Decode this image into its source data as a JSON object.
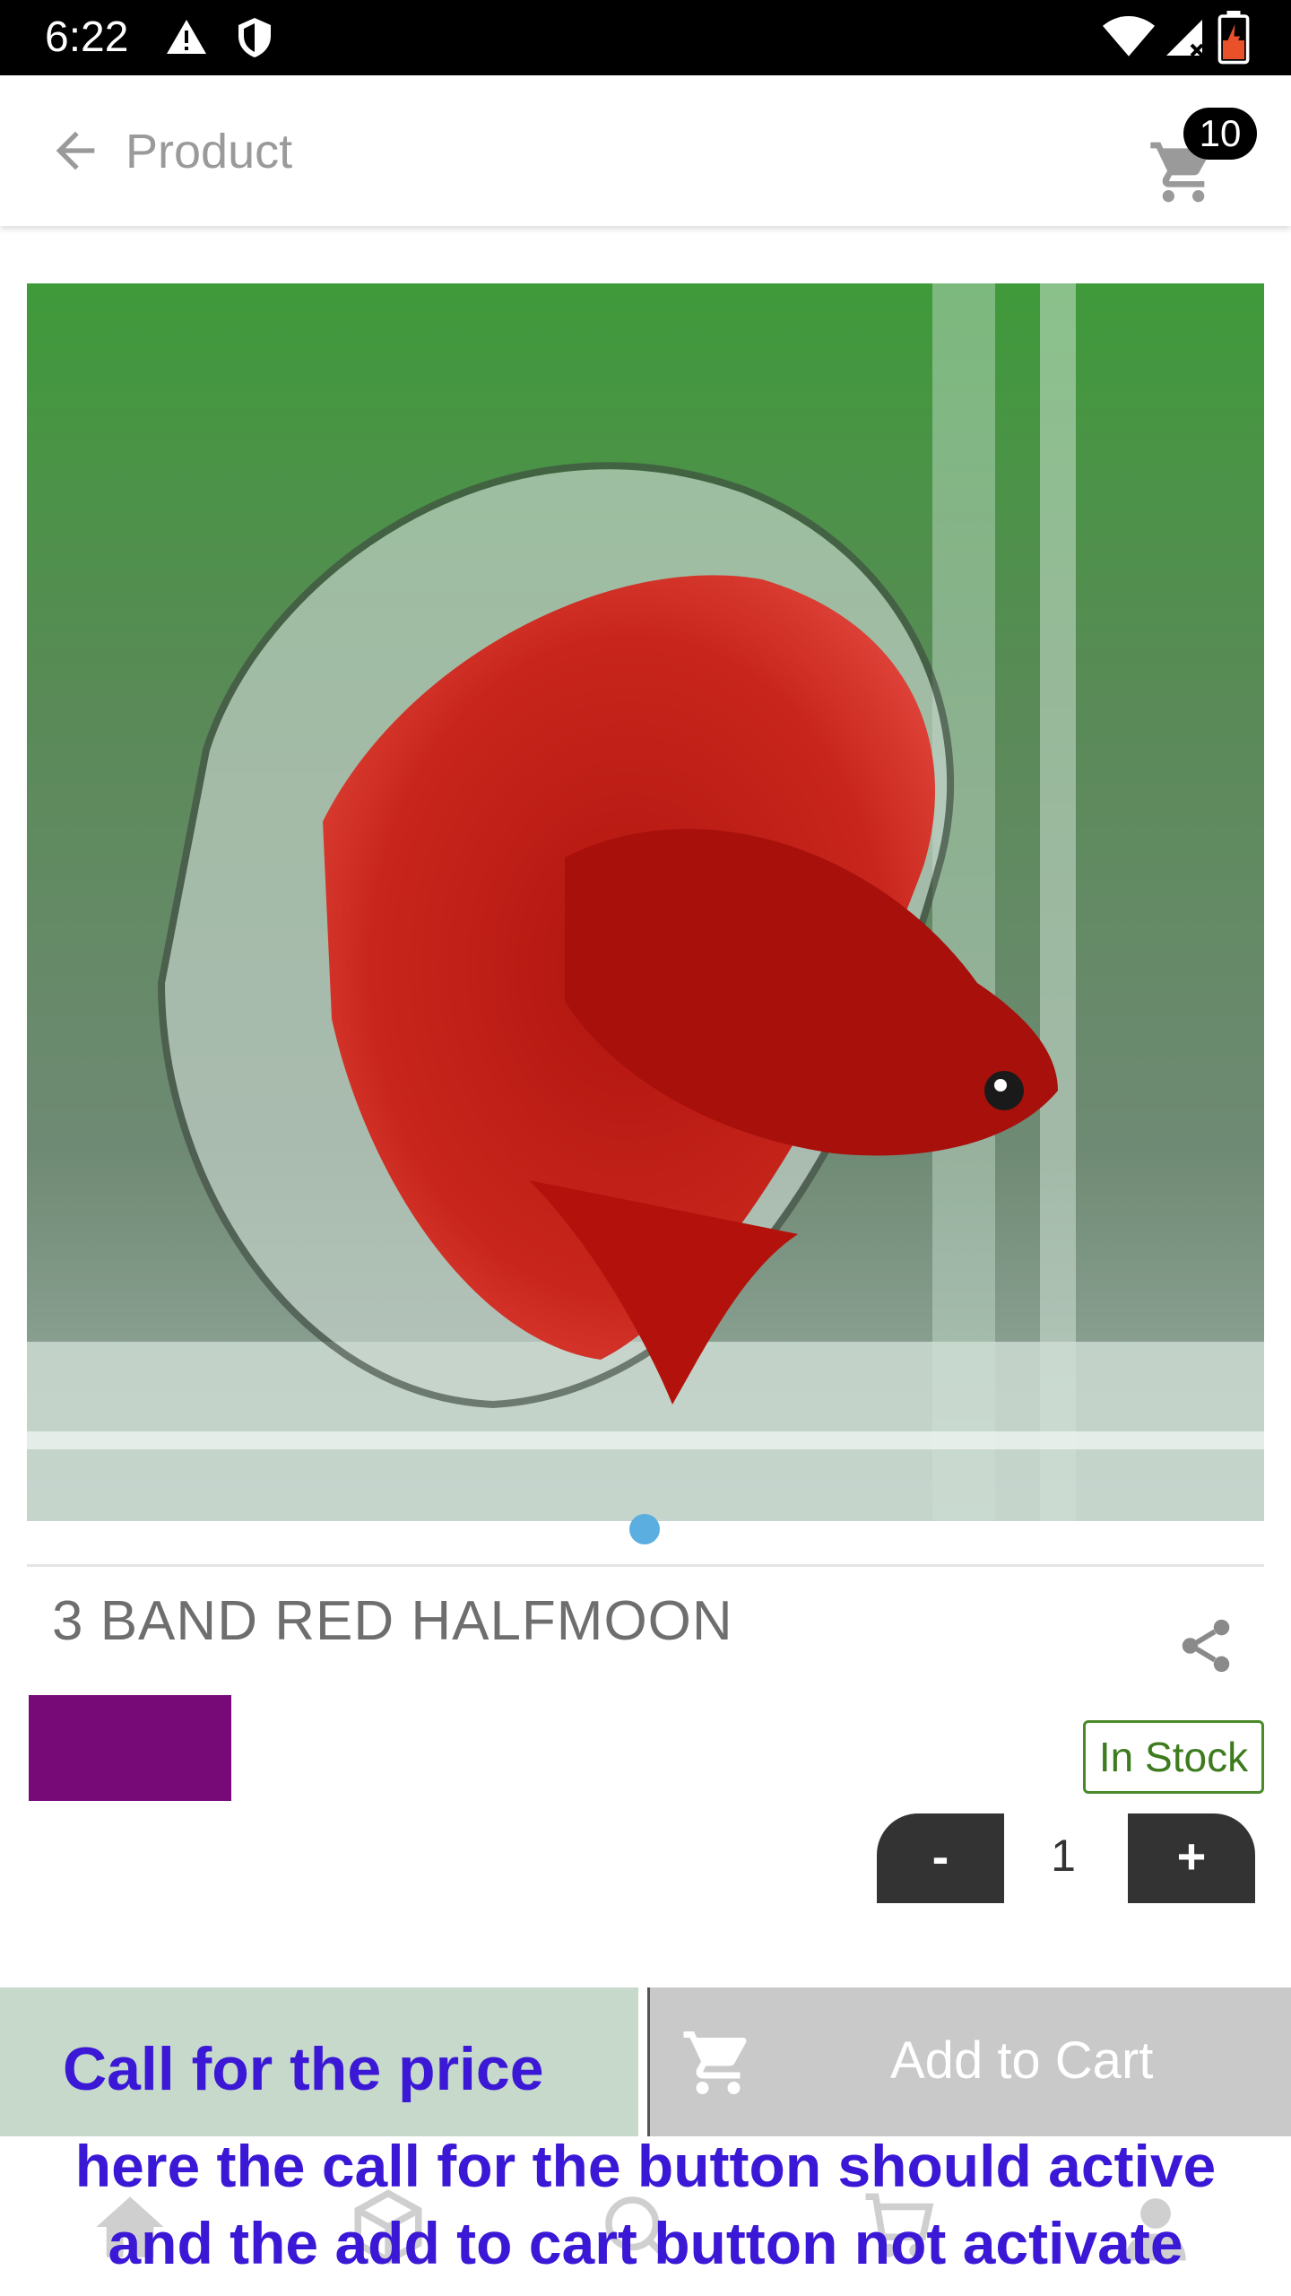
{
  "status_bar": {
    "time": "6:22"
  },
  "app_bar": {
    "title": "Product",
    "cart_count": "10"
  },
  "product": {
    "name": "3 BAND RED HALFMOON",
    "color_swatch": "#780a78",
    "stock_status": "In Stock",
    "quantity": "1",
    "minus_label": "-",
    "plus_label": "+",
    "image_icon": "betta-fish-photo"
  },
  "actions": {
    "call_label": "Call for the price",
    "add_to_cart_label": "Add to Cart"
  },
  "annotation": {
    "line1": "here the call for the button should active",
    "line2": "and the add to cart button not activate"
  },
  "colors": {
    "accent_text": "#3b17d6",
    "call_bg": "#c6d9cb",
    "cart_bg": "#c9c9c9",
    "stock_green": "#3e7a1e",
    "pager_dot": "#5aaee0"
  }
}
